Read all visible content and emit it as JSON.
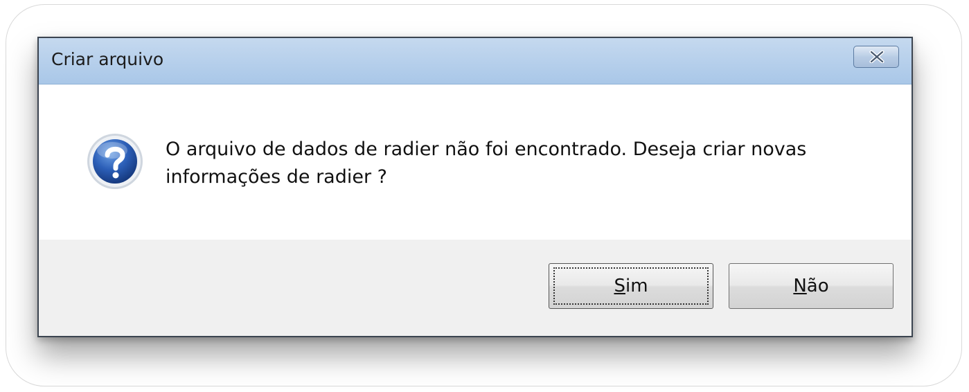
{
  "dialog": {
    "title": "Criar arquivo",
    "close_icon": "close-icon",
    "message": "O arquivo de dados de radier não foi encontrado. Deseja criar novas informações de radier ?",
    "icon": "question-icon"
  },
  "buttons": {
    "yes": {
      "accel": "S",
      "rest": "im"
    },
    "no": {
      "accel": "N",
      "rest": "ão"
    }
  }
}
